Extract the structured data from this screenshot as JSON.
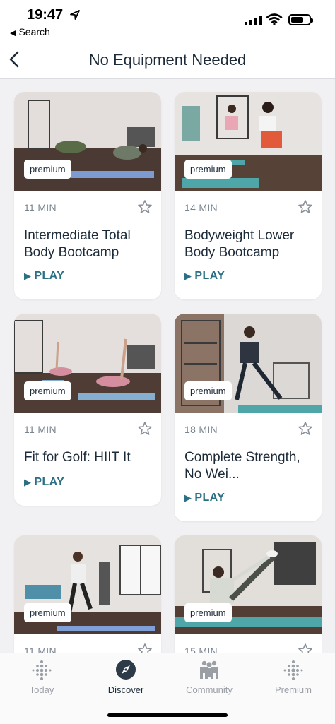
{
  "status_bar": {
    "time": "19:47",
    "back_app": "Search"
  },
  "header": {
    "title": "No Equipment Needed"
  },
  "workouts": [
    {
      "badge": "premium",
      "duration": "11 MIN",
      "title": "Intermediate Total Body Bootcamp",
      "action": "PLAY"
    },
    {
      "badge": "premium",
      "duration": "14 MIN",
      "title": "Bodyweight Lower Body Bootcamp",
      "action": "PLAY"
    },
    {
      "badge": "premium",
      "duration": "11 MIN",
      "title": "Fit for Golf: HIIT It",
      "action": "PLAY"
    },
    {
      "badge": "premium",
      "duration": "18 MIN",
      "title": "Complete Strength, No Wei...",
      "action": "PLAY"
    },
    {
      "badge": "premium",
      "duration": "11 MIN",
      "title": "",
      "action": ""
    },
    {
      "badge": "premium",
      "duration": "15 MIN",
      "title": "",
      "action": ""
    }
  ],
  "tabs": [
    {
      "label": "Today",
      "icon": "today-dots-icon",
      "active": false
    },
    {
      "label": "Discover",
      "icon": "compass-icon",
      "active": true
    },
    {
      "label": "Community",
      "icon": "community-people-icon",
      "active": false
    },
    {
      "label": "Premium",
      "icon": "premium-dots-icon",
      "active": false
    }
  ],
  "colors": {
    "accent": "#2a6f84",
    "text": "#1c2b39",
    "muted": "#7b8591",
    "background": "#f1f1f3"
  }
}
